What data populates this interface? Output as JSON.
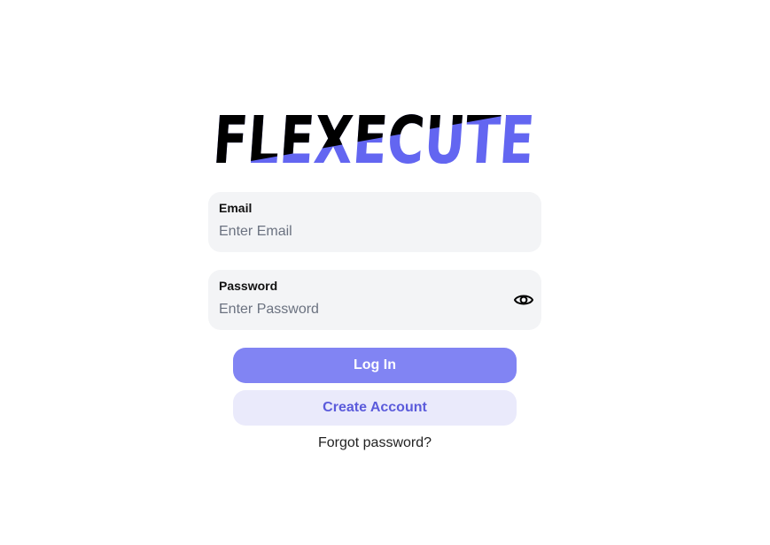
{
  "brand": {
    "name": "FLEXECUTE",
    "colors": {
      "primary": "#6366f1",
      "dark": "#000000"
    }
  },
  "login_form": {
    "email": {
      "label": "Email",
      "placeholder": "Enter Email",
      "value": ""
    },
    "password": {
      "label": "Password",
      "placeholder": "Enter Password",
      "value": "",
      "toggle_icon": "eye-icon"
    },
    "login_button": "Log In",
    "create_account_button": "Create Account",
    "forgot_password_link": "Forgot password?"
  },
  "theme": {
    "login_button_bg": "#8184f3",
    "create_button_bg": "#eaeafb",
    "create_button_text": "#5b5bdb",
    "field_bg": "#f3f4f6"
  }
}
